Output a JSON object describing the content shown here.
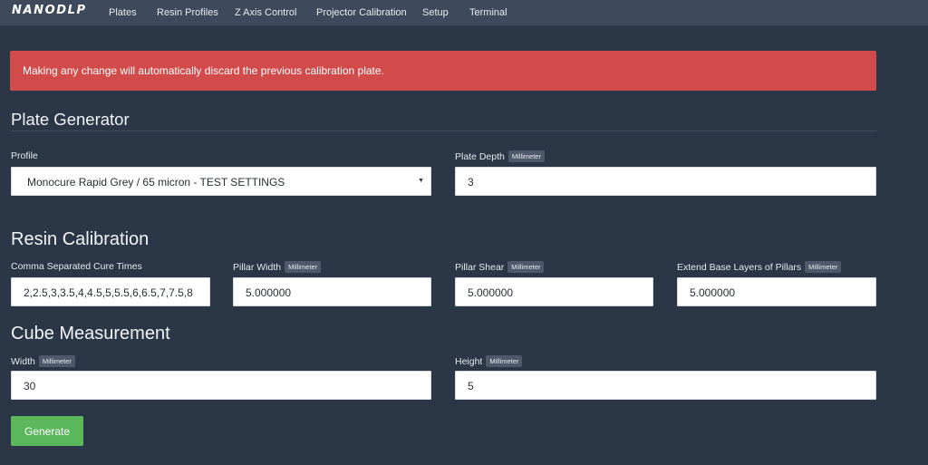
{
  "nav": {
    "brand": "NANODLP",
    "items": [
      "Plates",
      "Resin Profiles",
      "Z Axis Control",
      "Projector Calibration",
      "Setup",
      "Terminal"
    ]
  },
  "alert": {
    "text": "Making any change will automatically discard the previous calibration plate."
  },
  "plate_generator": {
    "title": "Plate Generator",
    "profile_label": "Profile",
    "profile_value": "Monocure Rapid Grey / 65 micron - TEST SETTINGS",
    "depth_label": "Plate Depth",
    "depth_unit": "Millimeter",
    "depth_value": "3"
  },
  "resin_calibration": {
    "title": "Resin Calibration",
    "cure_label": "Comma Separated Cure Times",
    "cure_value": "2,2.5,3,3.5,4,4.5,5,5.5,6,6.5,7,7.5,8",
    "width_label": "Pillar Width",
    "width_unit": "Millimeter",
    "width_value": "5.000000",
    "shear_label": "Pillar Shear",
    "shear_unit": "Millimeter",
    "shear_value": "5.000000",
    "extend_label": "Extend Base Layers of Pillars",
    "extend_unit": "Millimeter",
    "extend_value": "5.000000"
  },
  "cube_measurement": {
    "title": "Cube Measurement",
    "width_label": "Width",
    "width_unit": "Millimeter",
    "width_value": "30",
    "height_label": "Height",
    "height_unit": "Millimeter",
    "height_value": "5"
  },
  "actions": {
    "generate_label": "Generate"
  },
  "colors": {
    "background": "#2b3747",
    "navbar": "#3e4a5b",
    "alert": "#d14b4a",
    "primary_button": "#5cb85c"
  }
}
